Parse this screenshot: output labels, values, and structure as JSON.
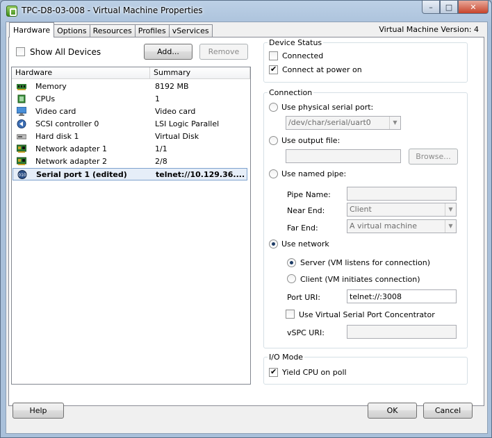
{
  "window": {
    "title": "TPC-D8-03-008 - Virtual Machine Properties",
    "buttons": {
      "minimize": "–",
      "maximize": "□",
      "close": "✕"
    }
  },
  "tabs": [
    {
      "label": "Hardware",
      "active": true
    },
    {
      "label": "Options",
      "active": false
    },
    {
      "label": "Resources",
      "active": false
    },
    {
      "label": "Profiles",
      "active": false
    },
    {
      "label": "vServices",
      "active": false
    }
  ],
  "vm_version": "Virtual Machine Version: 4",
  "hardware": {
    "show_all_devices": "Show All Devices",
    "add_label": "Add...",
    "remove_label": "Remove",
    "columns": [
      "Hardware",
      "Summary"
    ],
    "rows": [
      {
        "name": "Memory",
        "summary": "8192 MB",
        "icon": "memory-icon"
      },
      {
        "name": "CPUs",
        "summary": "1",
        "icon": "cpu-icon"
      },
      {
        "name": "Video card",
        "summary": "Video card",
        "icon": "video-card-icon"
      },
      {
        "name": "SCSI controller 0",
        "summary": "LSI Logic Parallel",
        "icon": "scsi-controller-icon"
      },
      {
        "name": "Hard disk 1",
        "summary": "Virtual Disk",
        "icon": "hard-disk-icon"
      },
      {
        "name": "Network adapter 1",
        "summary": "1/1",
        "icon": "network-adapter-icon"
      },
      {
        "name": "Network adapter 2",
        "summary": "2/8",
        "icon": "network-adapter-icon"
      },
      {
        "name": "Serial port 1 (edited)",
        "summary": "telnet://10.129.36....",
        "icon": "serial-port-icon",
        "selected": true
      }
    ]
  },
  "device_status": {
    "legend": "Device Status",
    "connected": "Connected",
    "connect_at_power_on": "Connect at power on"
  },
  "connection": {
    "legend": "Connection",
    "physical_serial_port": "Use physical serial port:",
    "physical_port_value": "/dev/char/serial/uart0",
    "output_file": "Use output file:",
    "browse_label": "Browse...",
    "named_pipe": "Use named pipe:",
    "pipe_name_label": "Pipe Name:",
    "near_end_label": "Near End:",
    "near_end_value": "Client",
    "far_end_label": "Far End:",
    "far_end_value": "A virtual machine",
    "use_network": "Use network",
    "server": "Server (VM listens for connection)",
    "client": "Client  (VM initiates connection)",
    "port_uri_label": "Port URI:",
    "port_uri_value": "telnet://:3008",
    "use_vspc": "Use Virtual Serial Port Concentrator",
    "vspc_uri_label": "vSPC URI:"
  },
  "io_mode": {
    "legend": "I/O Mode",
    "yield_cpu": "Yield CPU on poll"
  },
  "footer": {
    "help_label": "Help",
    "ok_label": "OK",
    "cancel_label": "Cancel"
  }
}
